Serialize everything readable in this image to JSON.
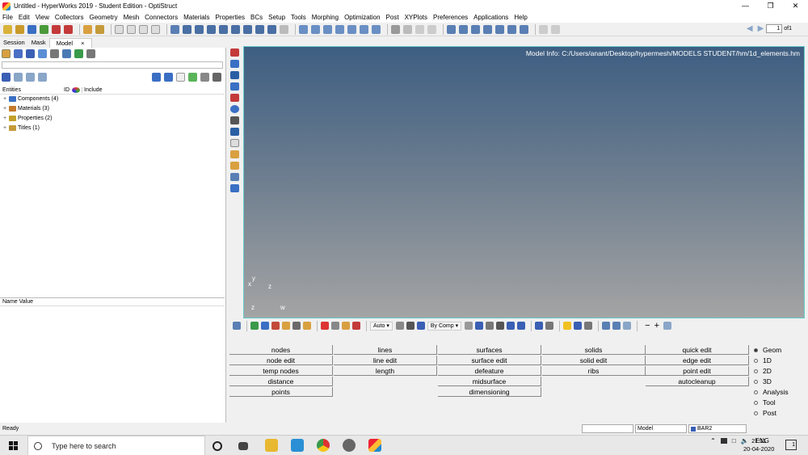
{
  "window": {
    "title": "Untitled - HyperWorks 2019 - Student Edition - OptiStruct",
    "controls": [
      "—",
      "❐",
      "✕"
    ]
  },
  "menu": [
    "File",
    "Edit",
    "View",
    "Collectors",
    "Geometry",
    "Mesh",
    "Connectors",
    "Materials",
    "Properties",
    "BCs",
    "Setup",
    "Tools",
    "Morphing",
    "Optimization",
    "Post",
    "XYPlots",
    "Preferences",
    "Applications",
    "Help"
  ],
  "pager": {
    "page": "1",
    "of": "of1"
  },
  "panel": {
    "tabs": [
      "Session",
      "Mask",
      "Model"
    ],
    "tab_close": "×",
    "columns": {
      "entities": "Entities",
      "id": "ID",
      "include": "Include"
    },
    "tree": [
      {
        "label": "Components (4)",
        "color": "#3a6fc4"
      },
      {
        "label": "Materials (3)",
        "color": "#c47a2a"
      },
      {
        "label": "Properties (2)",
        "color": "#c4a02a"
      },
      {
        "label": "Titles (1)",
        "color": "#c49a3a"
      }
    ],
    "name_value": "Name Value"
  },
  "viewport": {
    "model_info": "Model Info: C:/Users/anant/Desktop/hypermesh/MODELS STUDENT/hm/1d_elements.hm",
    "axis_labels": {
      "y": "y",
      "x": "x",
      "z1": "z",
      "z2": "z",
      "w": "w"
    }
  },
  "bottom_toolbar": {
    "auto": "Auto",
    "by_comp": "By Comp"
  },
  "panels": {
    "col1": [
      "nodes",
      "node edit",
      "temp nodes",
      "distance",
      "points"
    ],
    "col2": [
      "lines",
      "line edit",
      "length"
    ],
    "col3": [
      "surfaces",
      "surface edit",
      "defeature",
      "midsurface",
      "dimensioning"
    ],
    "col4": [
      "solids",
      "solid edit",
      "ribs"
    ],
    "col5": [
      "quick edit",
      "edge edit",
      "point edit",
      "autocleanup"
    ]
  },
  "radios": [
    "Geom",
    "1D",
    "2D",
    "3D",
    "Analysis",
    "Tool",
    "Post"
  ],
  "radio_selected": "Geom",
  "status": {
    "ready": "Ready",
    "model": "Model",
    "element": "BAR2"
  },
  "taskbar": {
    "search_placeholder": "Type here to search",
    "lang": "ENG",
    "time": "21:11",
    "date": "20-04-2020",
    "notifications": "1",
    "app_icons": [
      "task-view-icon",
      "file-explorer-icon",
      "lync-icon",
      "chrome-icon",
      "settings-icon",
      "hyperworks-icon"
    ]
  },
  "colors": {
    "viewport_top": "#3e5e82",
    "viewport_bottom": "#a4a4a4",
    "viewport_border": "#66cccc"
  }
}
